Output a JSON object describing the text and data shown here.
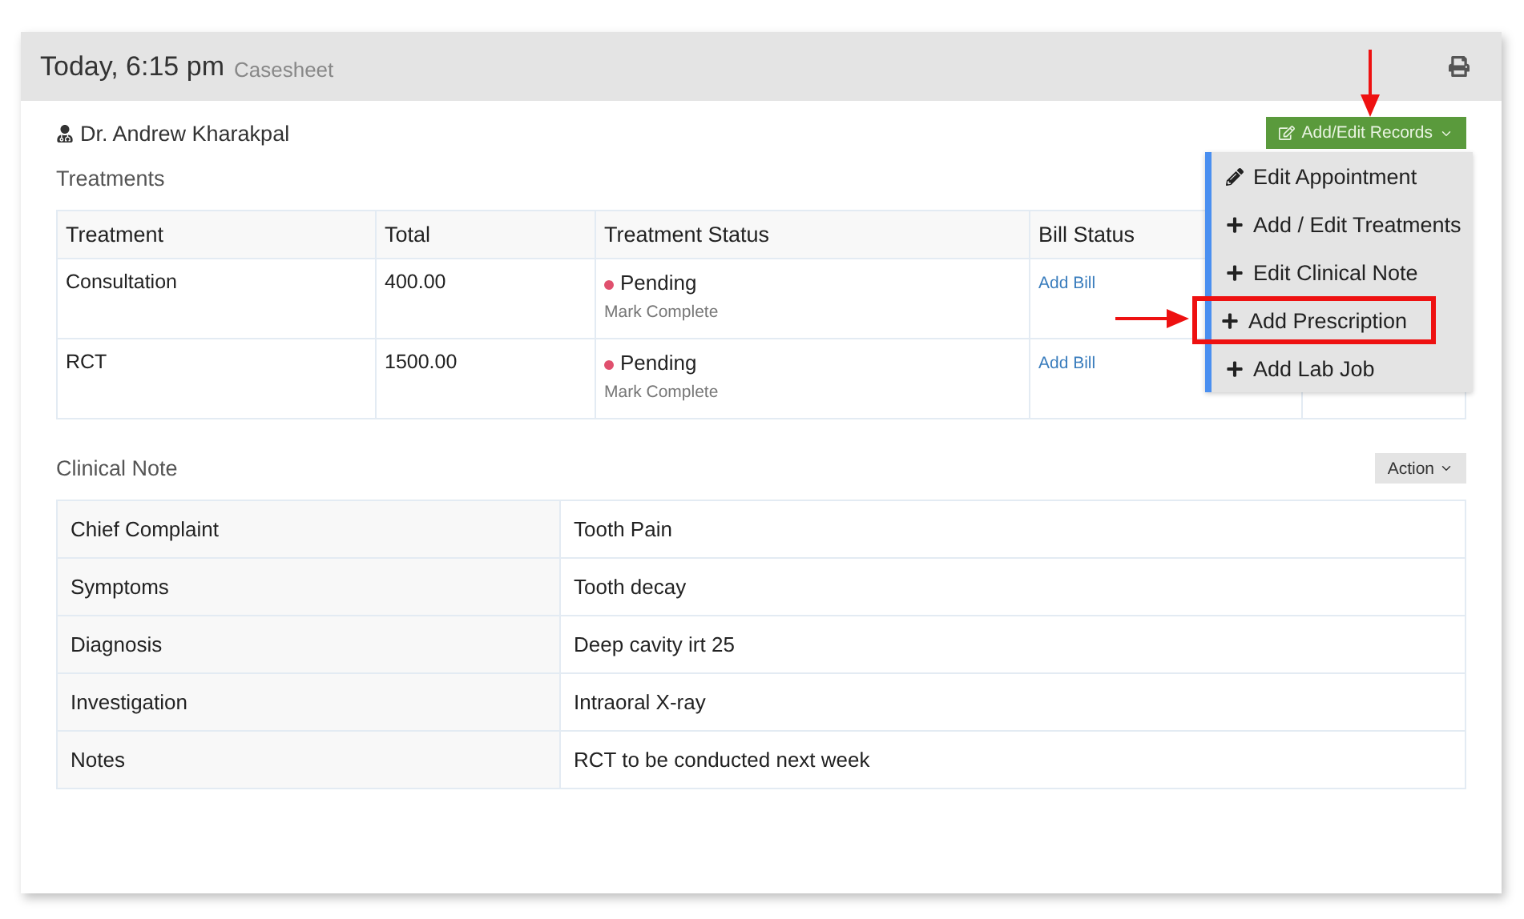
{
  "header": {
    "title": "Today, 6:15 pm",
    "subtitle": "Casesheet"
  },
  "doctor": "Dr. Andrew Kharakpal",
  "records_button": "Add/Edit Records",
  "records_menu": [
    {
      "kind": "edit",
      "label": "Edit Appointment",
      "annotated": false
    },
    {
      "kind": "add",
      "label": "Add / Edit Treatments",
      "annotated": false
    },
    {
      "kind": "add",
      "label": "Edit Clinical Note",
      "annotated": false
    },
    {
      "kind": "add",
      "label": "Add Prescription",
      "annotated": true
    },
    {
      "kind": "add",
      "label": "Add Lab Job",
      "annotated": false
    }
  ],
  "treatments": {
    "title": "Treatments",
    "columns": [
      "Treatment",
      "Total",
      "Treatment Status",
      "Bill Status"
    ],
    "rows": [
      {
        "treatment": "Consultation",
        "total": "400.00",
        "status": "Pending",
        "color": "#e0506e",
        "status_action": "Mark Complete",
        "bill": "Add Bill"
      },
      {
        "treatment": "RCT",
        "total": "1500.00",
        "status": "Pending",
        "color": "#e0506e",
        "status_action": "Mark Complete",
        "bill": "Add Bill"
      }
    ]
  },
  "clinical_note": {
    "title": "Clinical Note",
    "action_button": "Action",
    "rows": [
      {
        "label": "Chief Complaint",
        "value": "Tooth Pain"
      },
      {
        "label": "Symptoms",
        "value": "Tooth decay"
      },
      {
        "label": "Diagnosis",
        "value": "Deep cavity irt 25"
      },
      {
        "label": "Investigation",
        "value": "Intraoral X-ray"
      },
      {
        "label": "Notes",
        "value": "RCT to be conducted next week"
      }
    ]
  }
}
